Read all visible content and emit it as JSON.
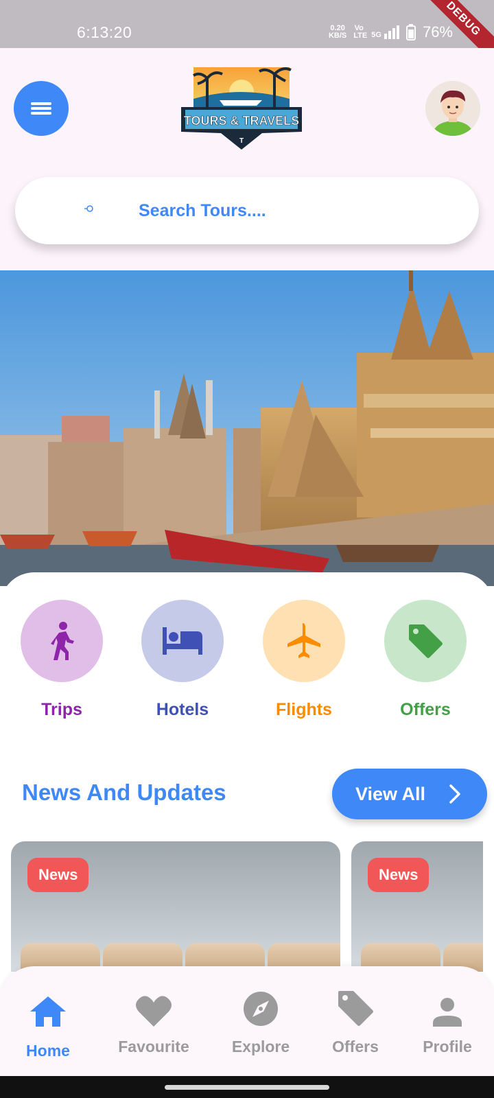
{
  "status_bar": {
    "time": "6:13:20",
    "speed_value": "0.20",
    "speed_unit": "KB/S",
    "volte": "Vo LTE",
    "network": "5G",
    "battery": "76%",
    "debug_banner": "DEBUG"
  },
  "header": {
    "logo_text": "TOURS & TRAVELS",
    "logo_sub": "T"
  },
  "search": {
    "placeholder": "Search Tours...."
  },
  "categories": [
    {
      "label": "Trips",
      "color": "#8e24aa",
      "bg": "#e1bee7",
      "icon": "walking-person-icon"
    },
    {
      "label": "Hotels",
      "color": "#3f51b5",
      "bg": "#c5cae9",
      "icon": "bed-icon"
    },
    {
      "label": "Flights",
      "color": "#fb8c00",
      "bg": "#ffe0b2",
      "icon": "airplane-icon"
    },
    {
      "label": "Offers",
      "color": "#43a047",
      "bg": "#c8e6c9",
      "icon": "tag-icon"
    }
  ],
  "news": {
    "title": "News And Updates",
    "view_all": "View All",
    "cards": [
      {
        "badge": "News"
      },
      {
        "badge": "News"
      }
    ]
  },
  "bottom_nav": {
    "items": [
      {
        "label": "Home",
        "icon": "home-icon",
        "active": true
      },
      {
        "label": "Favourite",
        "icon": "heart-icon",
        "active": false
      },
      {
        "label": "Explore",
        "icon": "compass-icon",
        "active": false
      },
      {
        "label": "Offers",
        "icon": "tag-icon",
        "active": false
      },
      {
        "label": "Profile",
        "icon": "person-icon",
        "active": false
      }
    ]
  },
  "colors": {
    "primary": "#3e88f7",
    "badge": "#f25757",
    "inactive": "#9b9b9b"
  }
}
